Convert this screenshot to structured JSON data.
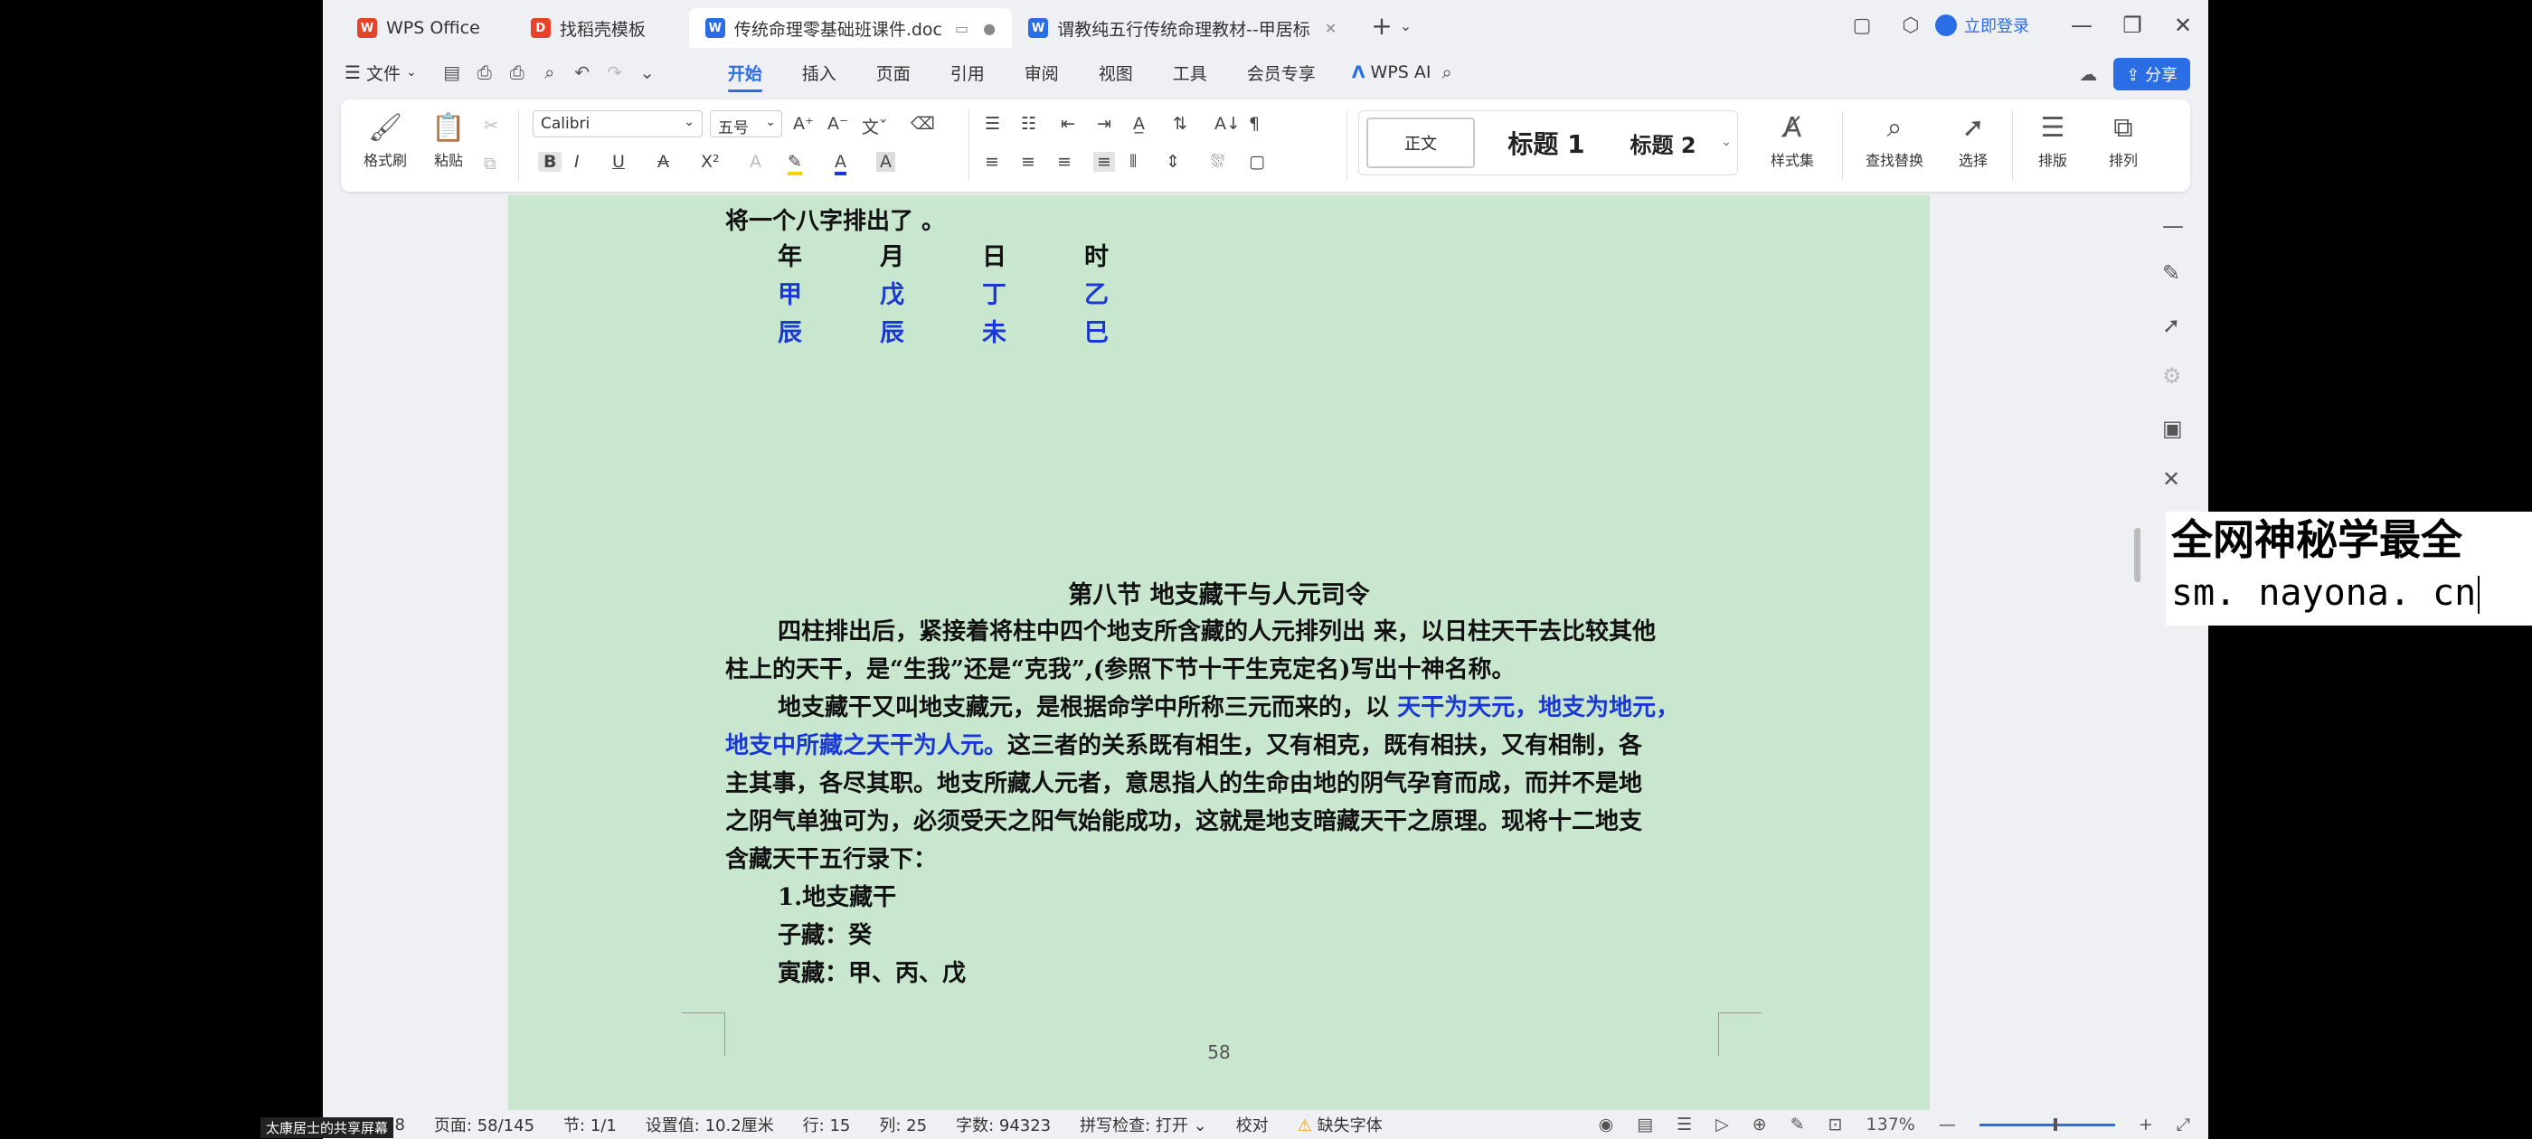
{
  "tabs": [
    {
      "label": "WPS Office",
      "icon": "wps-logo-icon",
      "color": "#e8432a"
    },
    {
      "label": "找稻壳模板",
      "icon": "docer-icon",
      "color": "#e8432a"
    },
    {
      "label": "传统命理零基础班课件.doc",
      "icon": "word-doc-icon",
      "color": "#2b6de5",
      "active": true
    },
    {
      "label": "谓教纯五行传统命理教材--甲居标",
      "icon": "word-doc-icon",
      "color": "#2b6de5"
    }
  ],
  "title_right": {
    "login": "立即登录"
  },
  "menu": {
    "file": "文件",
    "tabs": [
      "开始",
      "插入",
      "页面",
      "引用",
      "审阅",
      "视图",
      "工具",
      "会员专享"
    ],
    "wps_ai": "WPS AI",
    "share": "分享"
  },
  "ribbon": {
    "format_painter": "格式刷",
    "paste": "粘贴",
    "font_name": "Calibri",
    "font_size": "五号",
    "styles": [
      "正文",
      "标题 1",
      "标题 2"
    ],
    "style_gallery": "样式集",
    "find_replace": "查找替换",
    "select": "选择",
    "layout": "排版",
    "arrange": "排列"
  },
  "document": {
    "intro_line": "将一个八字排出了 。",
    "bazi_header": [
      "年",
      "月",
      "日",
      "时"
    ],
    "bazi_stems": [
      "甲",
      "戊",
      "丁",
      "乙"
    ],
    "bazi_branches": [
      "辰",
      "辰",
      "未",
      "巳"
    ],
    "section_title": "第八节  地支藏干与人元司令",
    "para1_line1": "四柱排出后，紧接着将柱中四个地支所含藏的人元排列出 来，以日柱天干去比较其他",
    "para1_line2": "柱上的天干，是“生我”还是“克我”,(参照下节十干生克定名)写出十神名称。",
    "para2_line1_black": "地支藏干又叫地支藏元，是根据命学中所称三元而来的，以 ",
    "para2_line1_blue": "天干为天元，地支为地元，",
    "para2_line2_blue": "地支中所藏之天干为人元。",
    "para2_line2_black": "这三者的关系既有相生，又有相克，既有相扶，又有相制，各",
    "para2_line3": "主其事，各尽其职。地支所藏人元者，意思指人的生命由地的阴气孕育而成，而并不是地",
    "para2_line4": "之阴气单独可为，必须受天之阳气始能成功，这就是地支暗藏天干之原理。现将十二地支",
    "para2_line5": "含藏天干五行录下：",
    "list_heading": "1.地支藏干",
    "zi_cang": "子藏：癸",
    "yin_cang": "寅藏：甲、丙、戊",
    "page_number": "58"
  },
  "statusbar": {
    "page": "58",
    "pages": "页面: 58/145",
    "section": "节: 1/1",
    "setting": "设置值: 10.2厘米",
    "row": "行: 15",
    "col": "列: 25",
    "wordcount": "字数: 94323",
    "spellcheck": "拼写检查: 打开",
    "proof": "校对",
    "missing_font": "缺失字体",
    "zoom": "137%"
  },
  "overlay": {
    "watermark_line1": "全网神秘学最全",
    "watermark_line2": "sm. nayona. cn",
    "share_label": "太康居士的共享屏幕"
  },
  "colors": {
    "accent": "#2b6de5",
    "page_bg": "#c9e6cf",
    "blue_text": "#1a39d4"
  }
}
